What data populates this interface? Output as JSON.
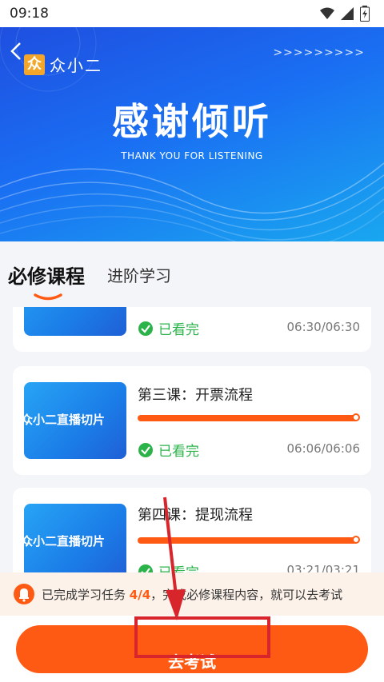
{
  "status_bar": {
    "time": "09:18"
  },
  "banner": {
    "logo_char": "众",
    "logo_text": "众小二",
    "arrows": ">>>>>>>>>",
    "title": "感谢倾听",
    "subtitle": "THANK YOU FOR LISTENING"
  },
  "tabs": [
    {
      "label": "必修课程",
      "active": true
    },
    {
      "label": "进阶学习",
      "active": false
    }
  ],
  "lessons": [
    {
      "title": "",
      "thumb_text": "",
      "status": "已看完",
      "duration": "06:30/06:30",
      "progress": 1.0
    },
    {
      "title": "第三课：开票流程",
      "thumb_text": "众小二直播切片",
      "status": "已看完",
      "duration": "06:06/06:06",
      "progress": 1.0
    },
    {
      "title": "第四课：提现流程",
      "thumb_text": "众小二直播切片",
      "status": "已看完",
      "duration": "03:21/03:21",
      "progress": 1.0
    }
  ],
  "notice": {
    "prefix": "已完成学习任务 ",
    "count": "4/4",
    "suffix": "，完成必修课程内容，就可以去考试"
  },
  "exam_button": {
    "label": "去考试"
  },
  "colors": {
    "accent": "#ff5a14",
    "success": "#2bb34a",
    "banner_blue": "#1a6ef2",
    "annotation_red": "#d8252b"
  }
}
